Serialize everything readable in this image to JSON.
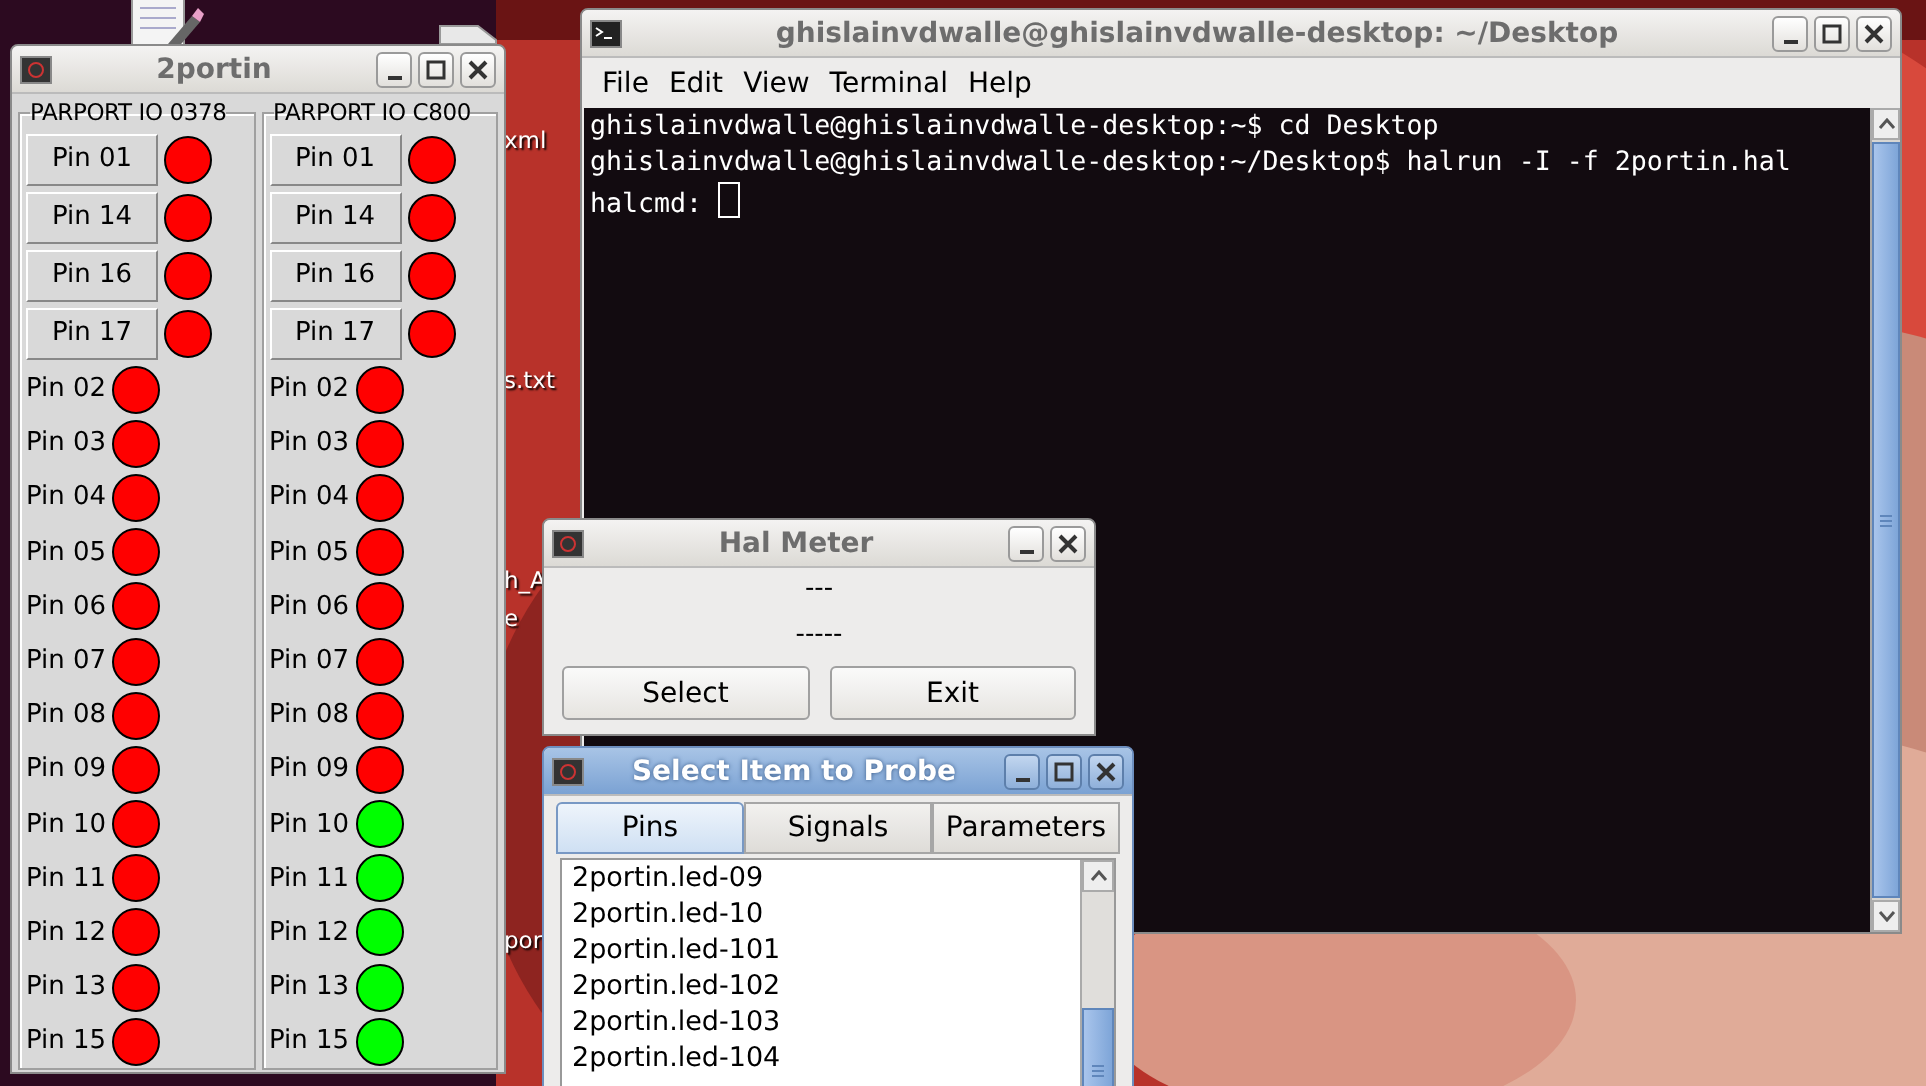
{
  "desktop": {
    "labels": [
      {
        "text": "xml"
      },
      {
        "text": "s.txt"
      },
      {
        "text": "h_A"
      },
      {
        "text": "e"
      },
      {
        "text": "por"
      }
    ]
  },
  "pin_window": {
    "title": "2portin",
    "groups": [
      {
        "title": "PARPORT IO 0378",
        "button_pins": [
          {
            "label": "Pin 01",
            "on": false
          },
          {
            "label": "Pin 14",
            "on": false
          },
          {
            "label": "Pin 16",
            "on": false
          },
          {
            "label": "Pin 17",
            "on": false
          }
        ],
        "pins": [
          {
            "label": "Pin 02",
            "on": false
          },
          {
            "label": "Pin 03",
            "on": false
          },
          {
            "label": "Pin 04",
            "on": false
          },
          {
            "label": "Pin 05",
            "on": false
          },
          {
            "label": "Pin 06",
            "on": false
          },
          {
            "label": "Pin 07",
            "on": false
          },
          {
            "label": "Pin 08",
            "on": false
          },
          {
            "label": "Pin 09",
            "on": false
          },
          {
            "label": "Pin 10",
            "on": false
          },
          {
            "label": "Pin 11",
            "on": false
          },
          {
            "label": "Pin 12",
            "on": false
          },
          {
            "label": "Pin 13",
            "on": false
          },
          {
            "label": "Pin 15",
            "on": false
          }
        ]
      },
      {
        "title": "PARPORT IO C800",
        "button_pins": [
          {
            "label": "Pin 01",
            "on": false
          },
          {
            "label": "Pin 14",
            "on": false
          },
          {
            "label": "Pin 16",
            "on": false
          },
          {
            "label": "Pin 17",
            "on": false
          }
        ],
        "pins": [
          {
            "label": "Pin 02",
            "on": false
          },
          {
            "label": "Pin 03",
            "on": false
          },
          {
            "label": "Pin 04",
            "on": false
          },
          {
            "label": "Pin 05",
            "on": false
          },
          {
            "label": "Pin 06",
            "on": false
          },
          {
            "label": "Pin 07",
            "on": false
          },
          {
            "label": "Pin 08",
            "on": false
          },
          {
            "label": "Pin 09",
            "on": false
          },
          {
            "label": "Pin 10",
            "on": true
          },
          {
            "label": "Pin 11",
            "on": true
          },
          {
            "label": "Pin 12",
            "on": true
          },
          {
            "label": "Pin 13",
            "on": true
          },
          {
            "label": "Pin 15",
            "on": true
          }
        ]
      }
    ]
  },
  "terminal": {
    "title": "ghislainvdwalle@ghislainvdwalle-desktop: ~/Desktop",
    "menu": [
      "File",
      "Edit",
      "View",
      "Terminal",
      "Help"
    ],
    "lines": [
      "ghislainvdwalle@ghislainvdwalle-desktop:~$ cd Desktop",
      "ghislainvdwalle@ghislainvdwalle-desktop:~/Desktop$ halrun -I -f 2portin.hal",
      "halcmd: "
    ],
    "cursor": true
  },
  "hal_meter": {
    "title": "Hal Meter",
    "value": "---",
    "reading": "-----",
    "buttons": [
      "Select",
      "Exit"
    ]
  },
  "probe_window": {
    "title": "Select Item to Probe",
    "tabs": [
      {
        "label": "Pins",
        "selected": true
      },
      {
        "label": "Signals",
        "selected": false
      },
      {
        "label": "Parameters",
        "selected": false
      }
    ],
    "items": [
      "2portin.led-09",
      "2portin.led-10",
      "2portin.led-101",
      "2portin.led-102",
      "2portin.led-103",
      "2portin.led-104"
    ]
  }
}
